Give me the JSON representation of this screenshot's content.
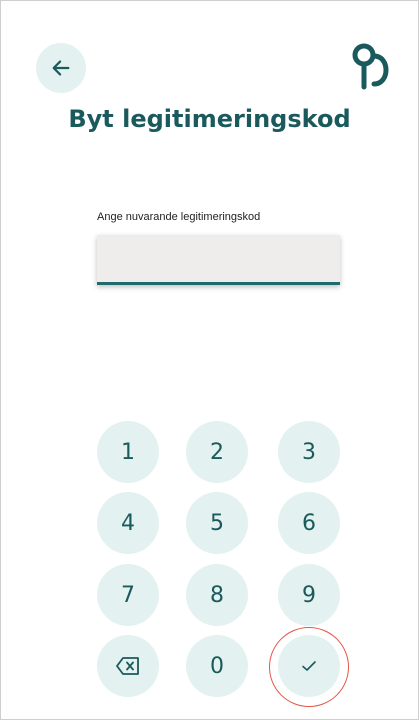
{
  "header": {
    "back_icon": "arrow-left-icon",
    "logo_icon": "app-logo-icon",
    "title": "Byt legitimeringskod"
  },
  "form": {
    "label": "Ange nuvarande legitimeringskod",
    "value": ""
  },
  "keypad": {
    "keys": [
      "1",
      "2",
      "3",
      "4",
      "5",
      "6",
      "7",
      "8",
      "9",
      "0"
    ],
    "backspace_icon": "backspace-icon",
    "confirm_icon": "checkmark-icon"
  },
  "colors": {
    "accent": "#1a5a5c",
    "key_background": "#e3f1f1",
    "highlight_ring": "#e4564a"
  }
}
